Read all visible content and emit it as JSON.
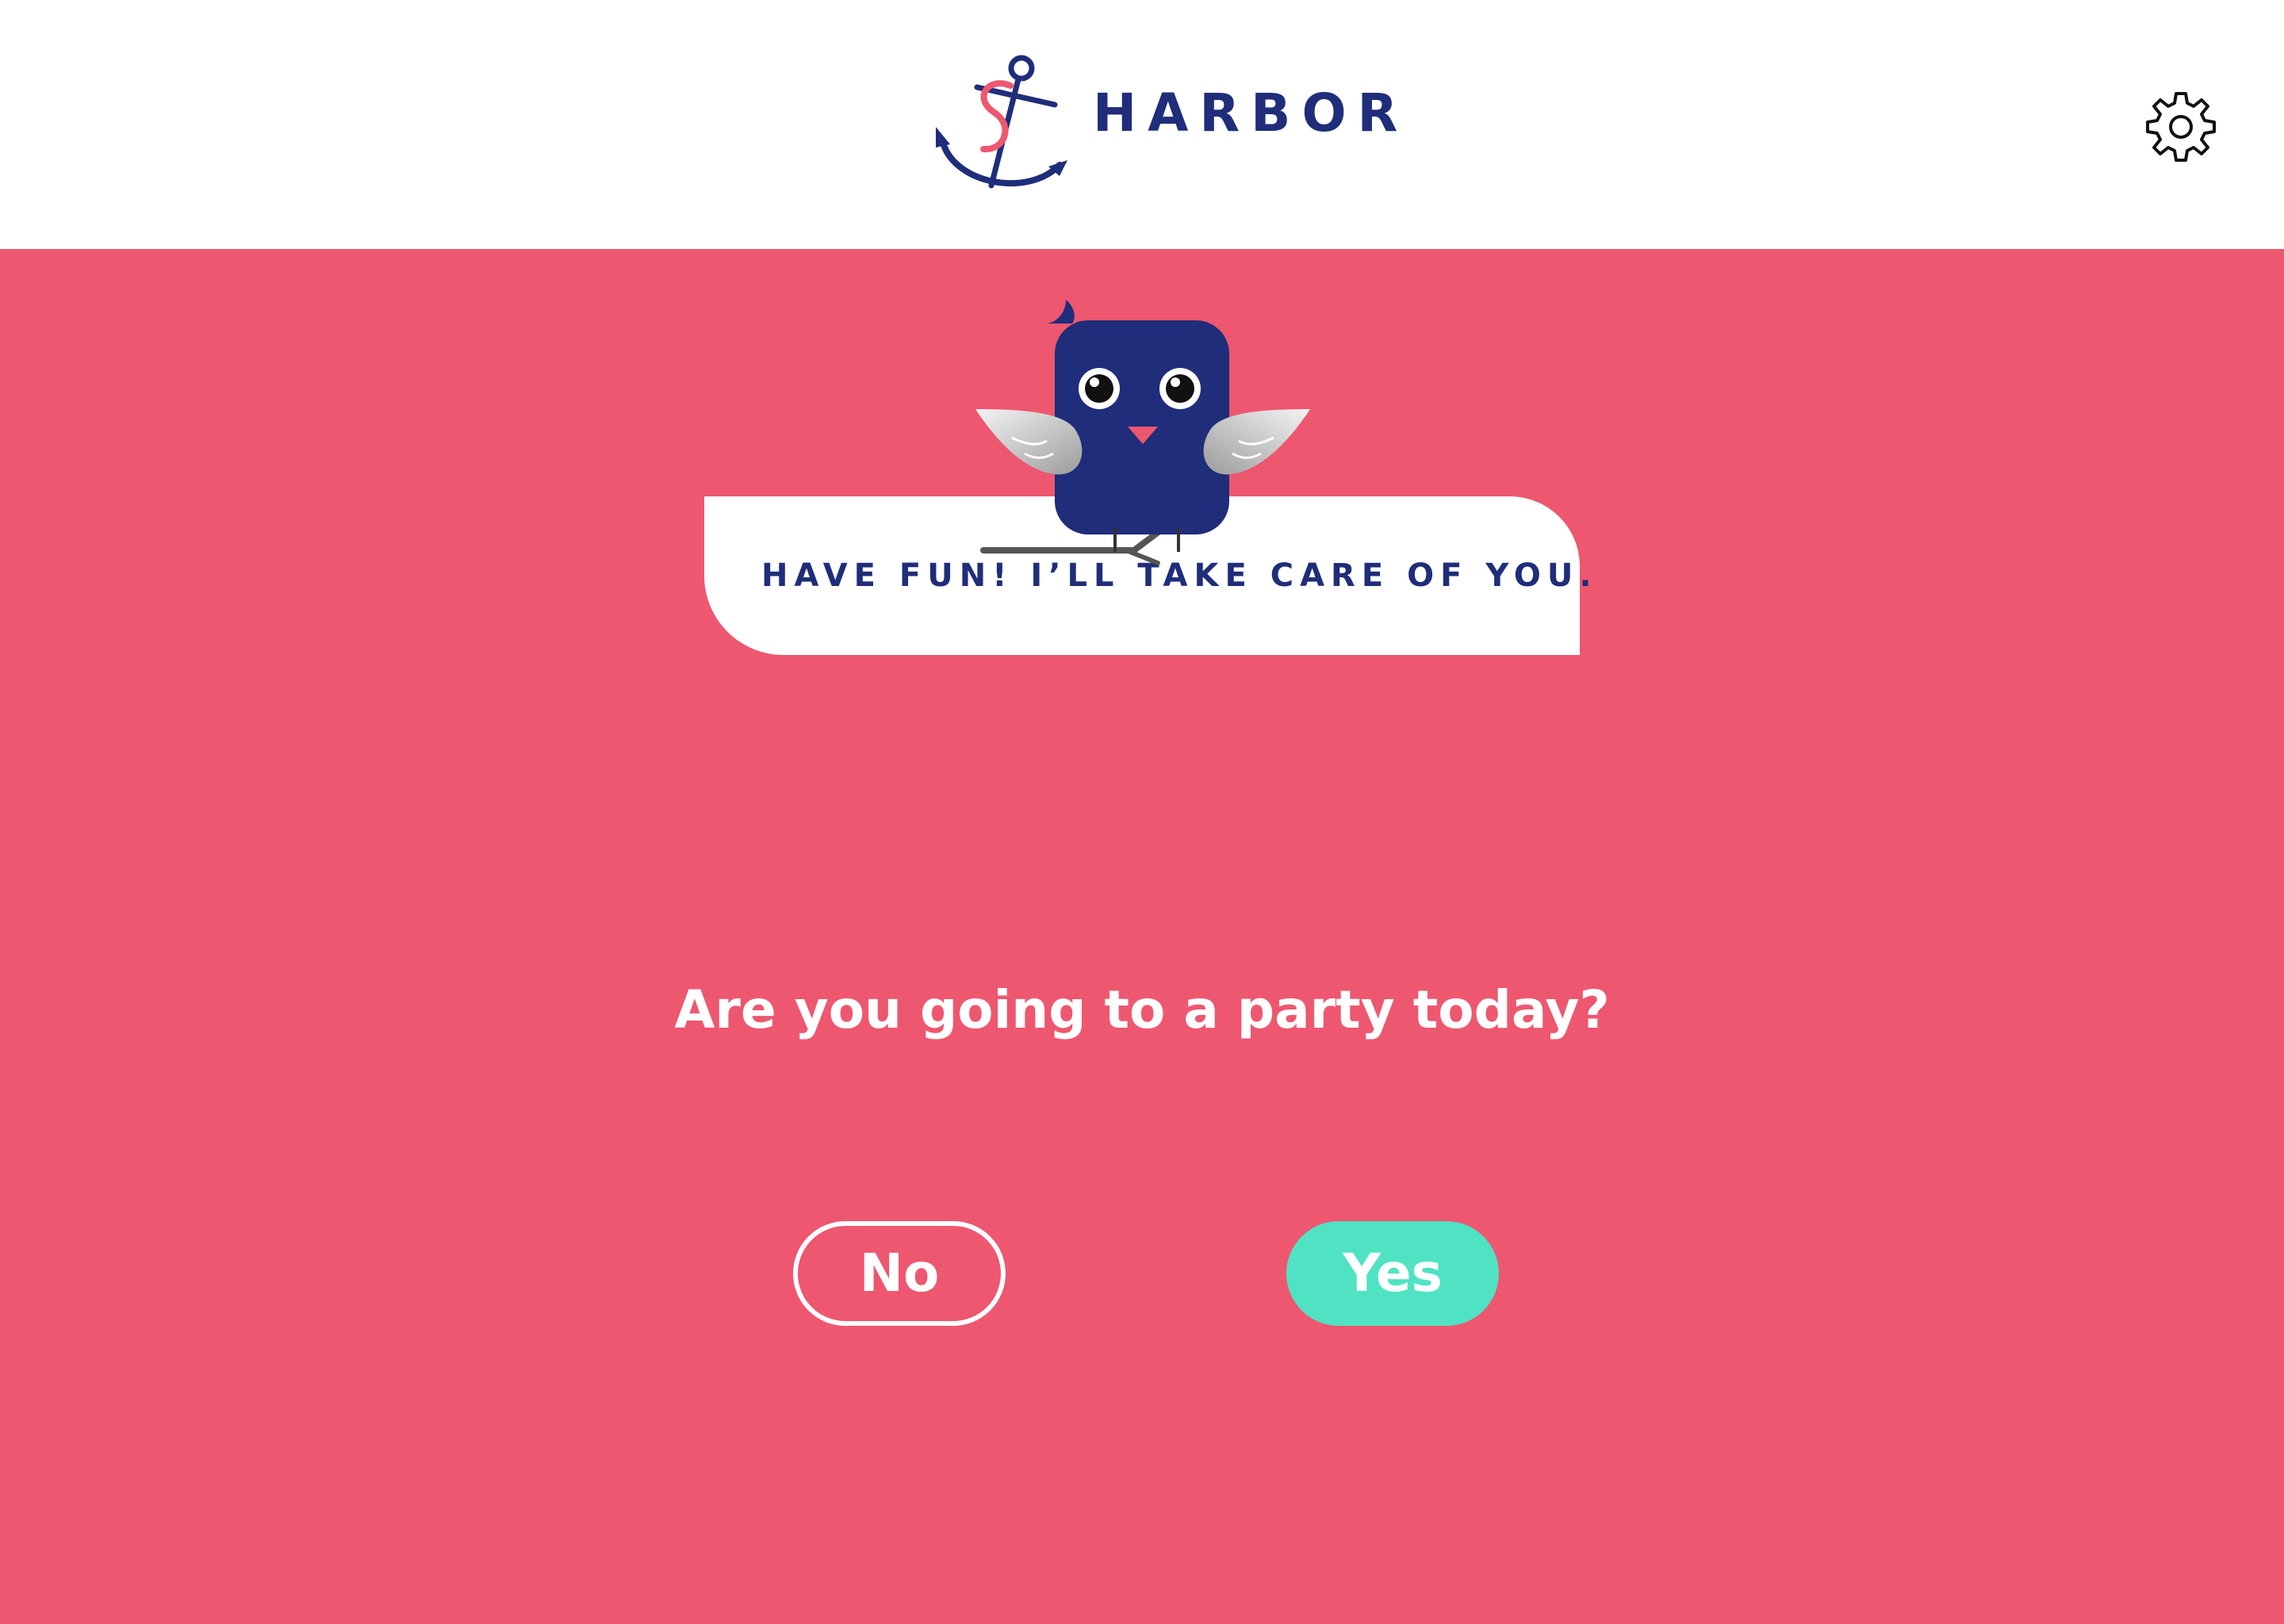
{
  "header": {
    "brand_name": "HARBOR",
    "logo_icon": "anchor-dollar-logo",
    "settings_icon": "gear-icon"
  },
  "mascot": {
    "icon": "bird-mascot",
    "speech": "HAVE FUN! I’LL TAKE CARE OF YOU."
  },
  "prompt": {
    "question": "Are you going to a party today?"
  },
  "actions": {
    "no_label": "No",
    "yes_label": "Yes"
  },
  "colors": {
    "background": "#ee5770",
    "navy": "#1f2d7a",
    "accent": "#4fe3c3",
    "white": "#ffffff"
  }
}
